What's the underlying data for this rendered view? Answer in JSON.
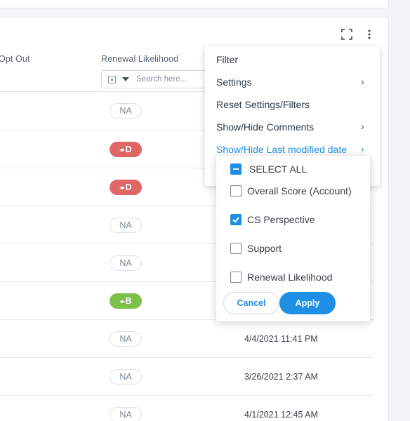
{
  "table": {
    "headers": {
      "opt_out": "Opt Out",
      "renewal_likelihood": "Renewal Likelihood"
    },
    "filter": {
      "placeholder": "Search here..."
    },
    "rows": [
      {
        "renewal": "NA",
        "renewal_color": "neutral",
        "last_modified": ""
      },
      {
        "renewal": "D",
        "renewal_color": "#e06666",
        "last_modified": ""
      },
      {
        "renewal": "D",
        "renewal_color": "#e06666",
        "last_modified": ""
      },
      {
        "renewal": "NA",
        "renewal_color": "neutral",
        "last_modified": ""
      },
      {
        "renewal": "NA",
        "renewal_color": "neutral",
        "last_modified": ""
      },
      {
        "renewal": "B",
        "renewal_color": "#7cc04a",
        "last_modified": ""
      },
      {
        "renewal": "NA",
        "renewal_color": "neutral",
        "last_modified": "4/4/2021 11:41 PM"
      },
      {
        "renewal": "NA",
        "renewal_color": "neutral",
        "last_modified": "3/26/2021 2:37 AM"
      },
      {
        "renewal": "NA",
        "renewal_color": "neutral",
        "last_modified": "4/1/2021 12:45 AM"
      }
    ]
  },
  "toolbar": {
    "expand_icon": "expand-icon",
    "more_icon": "kebab-menu-icon"
  },
  "menu": {
    "items": [
      {
        "label": "Filter",
        "has_submenu": false,
        "active": false
      },
      {
        "label": "Settings",
        "has_submenu": true,
        "active": false
      },
      {
        "label": "Reset Settings/Filters",
        "has_submenu": false,
        "active": false
      },
      {
        "label": "Show/Hide Comments",
        "has_submenu": true,
        "active": false
      },
      {
        "label": "Show/Hide Last modified date",
        "has_submenu": true,
        "active": true
      }
    ]
  },
  "submenu": {
    "select_all": {
      "label": "SELECT ALL",
      "state": "indeterminate"
    },
    "options": [
      {
        "label": "Overall Score (Account)",
        "checked": false
      },
      {
        "label": "CS Perspective",
        "checked": true
      },
      {
        "label": "Support",
        "checked": false
      },
      {
        "label": "Renewal Likelihood",
        "checked": false
      }
    ],
    "cancel_label": "Cancel",
    "apply_label": "Apply"
  },
  "colors": {
    "accent": "#1f8fe5",
    "grade_d": "#e06666",
    "grade_b": "#7cc04a"
  }
}
